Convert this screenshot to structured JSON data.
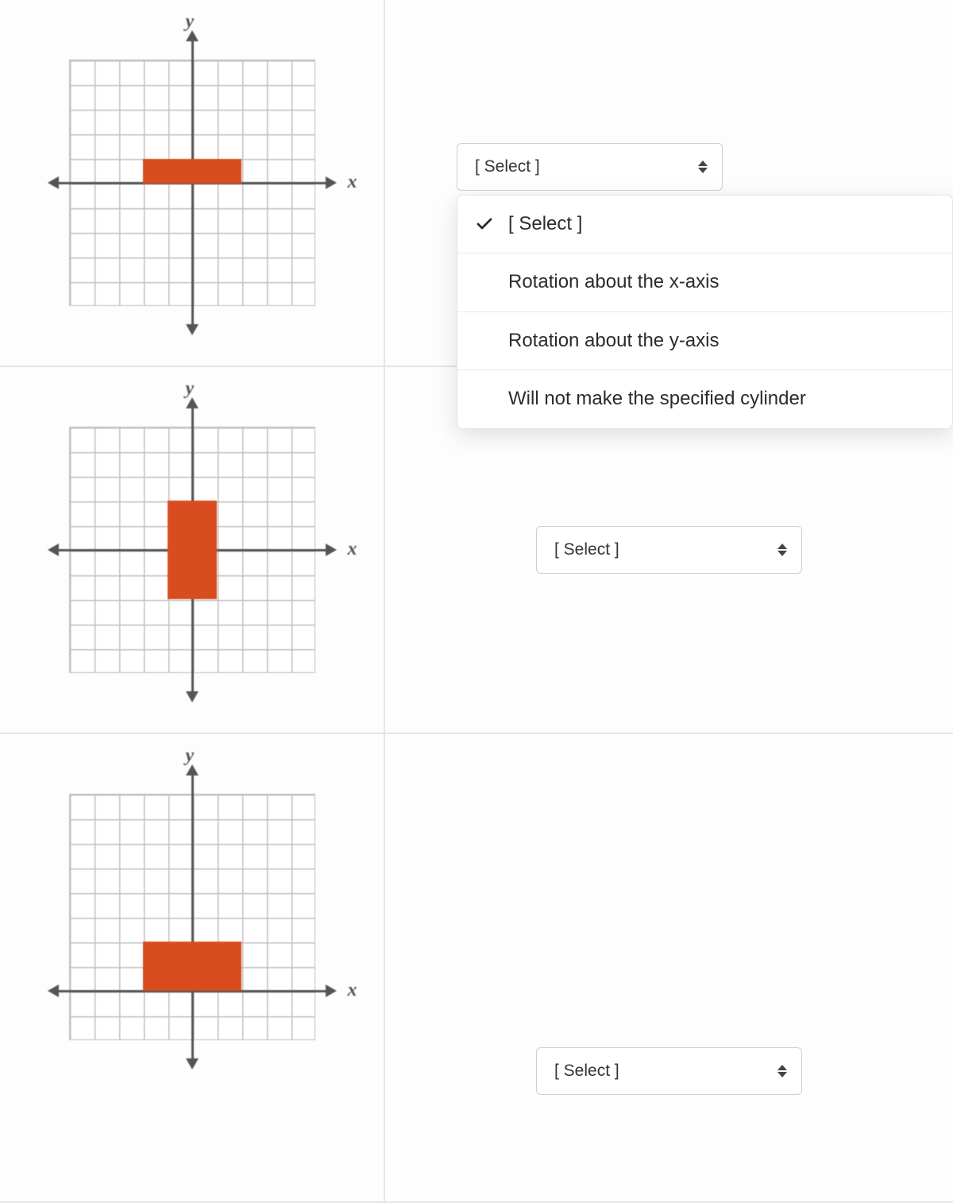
{
  "axis": {
    "x": "x",
    "y": "y"
  },
  "select_placeholder": "[ Select ]",
  "dropdown": {
    "options": [
      "[ Select ]",
      "Rotation about the x-axis",
      "Rotation about the y-axis",
      "Will not make the specified cylinder"
    ],
    "selected_index": 0
  },
  "rows": [
    {
      "select_value": "[ Select ]",
      "open": true
    },
    {
      "select_value": "[ Select ]",
      "open": false
    },
    {
      "select_value": "[ Select ]",
      "open": false
    }
  ]
}
